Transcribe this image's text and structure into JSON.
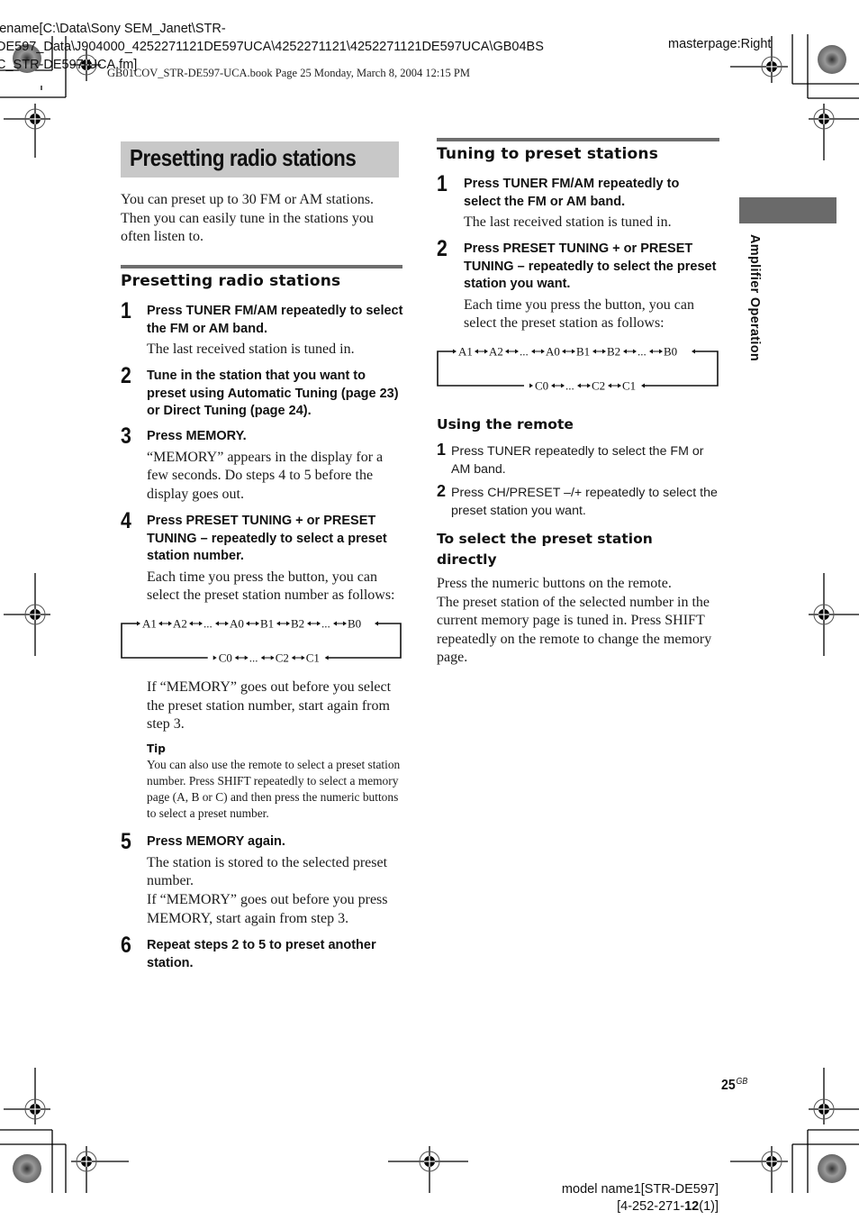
{
  "header": {
    "filename_lines": [
      "lename[C:\\Data\\Sony SEM_Janet\\STR-",
      "DE597_Data\\J904000_4252271121DE597UCA\\4252271121\\4252271121DE597UCA\\GB04BS",
      "C_STR-DE597-UCA.fm]"
    ],
    "book_line": "GB01COV_STR-DE597-UCA.book  Page 25  Monday, March 8, 2004  12:15 PM",
    "masterpage": "masterpage:Right"
  },
  "left_column": {
    "page_title": "Presetting radio stations",
    "intro": "You can preset up to 30 FM or AM stations. Then you can easily tune in the stations you often listen to.",
    "section_heading": "Presetting radio stations",
    "steps": [
      {
        "num": "1",
        "title": "Press TUNER FM/AM repeatedly to select the FM or AM band.",
        "desc": "The last received station is tuned in."
      },
      {
        "num": "2",
        "title": "Tune in the station that you want to preset using Automatic Tuning (page 23) or Direct Tuning (page 24).",
        "desc": ""
      },
      {
        "num": "3",
        "title": "Press MEMORY.",
        "desc": "“MEMORY” appears in the display for a few seconds. Do steps 4 to 5 before the display goes out."
      },
      {
        "num": "4",
        "title": "Press PRESET TUNING + or PRESET TUNING – repeatedly to select a preset station number.",
        "desc": "Each time you press the button, you can select the preset station number as follows:"
      },
      {
        "num": "5",
        "title": "Press MEMORY again.",
        "desc": "The station is stored to the selected preset number.\nIf “MEMORY” goes out before you press MEMORY, start again from step 3."
      },
      {
        "num": "6",
        "title": "Repeat steps 2 to 5 to preset another station.",
        "desc": ""
      }
    ],
    "step4_after": "If “MEMORY” goes out before you select the preset station number, start again from step 3.",
    "tip": {
      "label": "Tip",
      "text": "You can also use the remote to select a preset station number. Press SHIFT repeatedly to select a memory page (A, B or C) and then press the numeric buttons to select a preset number."
    }
  },
  "preset_cycle": {
    "top_row": [
      "A1",
      "A2",
      "...",
      "A0",
      "B1",
      "B2",
      "...",
      "B0"
    ],
    "bottom_row": [
      "C0",
      "...",
      "C2",
      "C1"
    ]
  },
  "right_column": {
    "section_heading": "Tuning to preset stations",
    "steps": [
      {
        "num": "1",
        "title": "Press TUNER FM/AM repeatedly to select the FM or AM band.",
        "desc": "The last received station is tuned in."
      },
      {
        "num": "2",
        "title": "Press PRESET TUNING + or PRESET TUNING – repeatedly to select the preset station you want.",
        "desc": "Each time you press the button, you can select the preset station as follows:"
      }
    ],
    "remote_heading": "Using the remote",
    "remote_steps": [
      {
        "num": "1",
        "text": "Press TUNER repeatedly to select the FM or AM band."
      },
      {
        "num": "2",
        "text": "Press CH/PRESET –/+ repeatedly to select the preset station you want."
      }
    ],
    "direct_heading": "To select the preset station directly",
    "direct_text": "Press the numeric buttons on the remote.\nThe preset station of the selected number in the current memory page is tuned in. Press SHIFT repeatedly on the remote to change the memory page."
  },
  "side_tab": {
    "label": "Amplifier Operation"
  },
  "footer": {
    "page_number": "25",
    "page_suffix": "GB",
    "model_line": "model name1[STR-DE597]",
    "code_prefix": "[4-252-271-",
    "code_bold": "12",
    "code_suffix": "(1)]"
  }
}
